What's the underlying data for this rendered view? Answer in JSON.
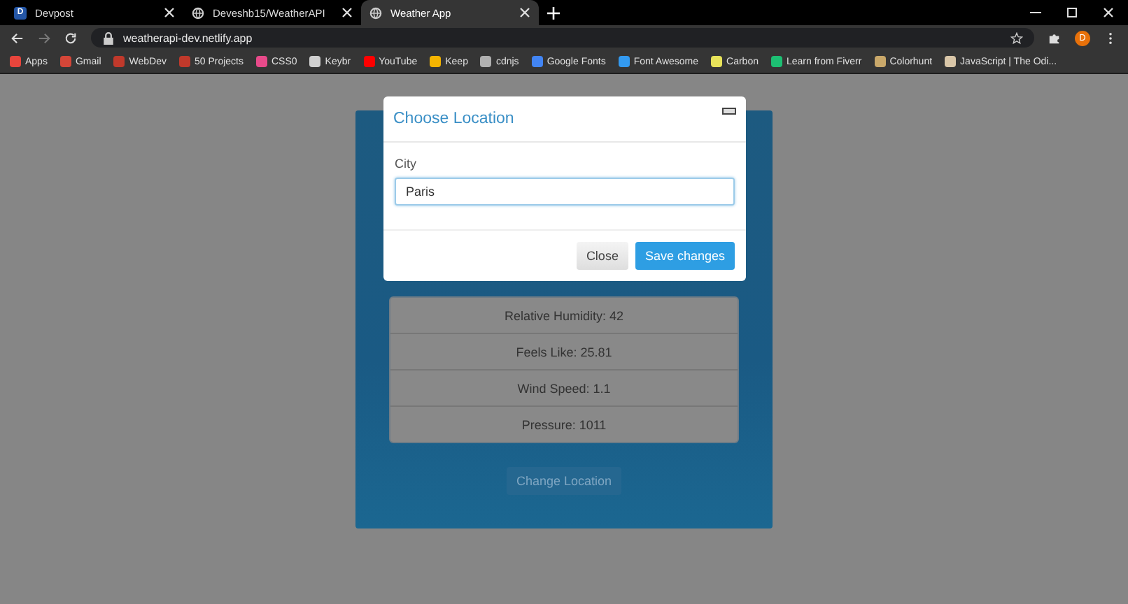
{
  "browser": {
    "tabs": [
      {
        "title": "Devpost",
        "icon": "D",
        "selected": false
      },
      {
        "title": "Deveshb15/WeatherAPI",
        "selected": false
      },
      {
        "title": "Weather App",
        "selected": true
      }
    ],
    "address": "weatherapi-dev.netlify.app",
    "profile_initial": "D",
    "bookmarks": [
      {
        "label": "Apps",
        "color": "#e8453c"
      },
      {
        "label": "Gmail",
        "color": "#d44638"
      },
      {
        "label": "WebDev",
        "color": "#c0392b"
      },
      {
        "label": "50 Projects",
        "color": "#c0392b"
      },
      {
        "label": "CSS0",
        "color": "#e84a8a"
      },
      {
        "label": "Keybr",
        "color": "#d0d0d0"
      },
      {
        "label": "YouTube",
        "color": "#ff0000"
      },
      {
        "label": "Keep",
        "color": "#f4b400"
      },
      {
        "label": "cdnjs",
        "color": "#b0b0b0"
      },
      {
        "label": "Google Fonts",
        "color": "#4285f4"
      },
      {
        "label": "Font Awesome",
        "color": "#339af0"
      },
      {
        "label": "Carbon",
        "color": "#e8e35a"
      },
      {
        "label": "Learn from Fiverr",
        "color": "#1dbf73"
      },
      {
        "label": "Colorhunt",
        "color": "#c9a86a"
      },
      {
        "label": "JavaScript | The Odi...",
        "color": "#d9c6a8"
      }
    ]
  },
  "weather": {
    "details": [
      "Relative Humidity: 42",
      "Feels Like: 25.81",
      "Wind Speed: 1.1",
      "Pressure: 1011"
    ],
    "change_button": "Change Location"
  },
  "modal": {
    "title": "Choose Location",
    "field_label": "City",
    "field_value": "Paris",
    "buttons": [
      {
        "label": "Close",
        "kind": "secondary"
      },
      {
        "label": "Save changes",
        "kind": "primary"
      }
    ]
  }
}
